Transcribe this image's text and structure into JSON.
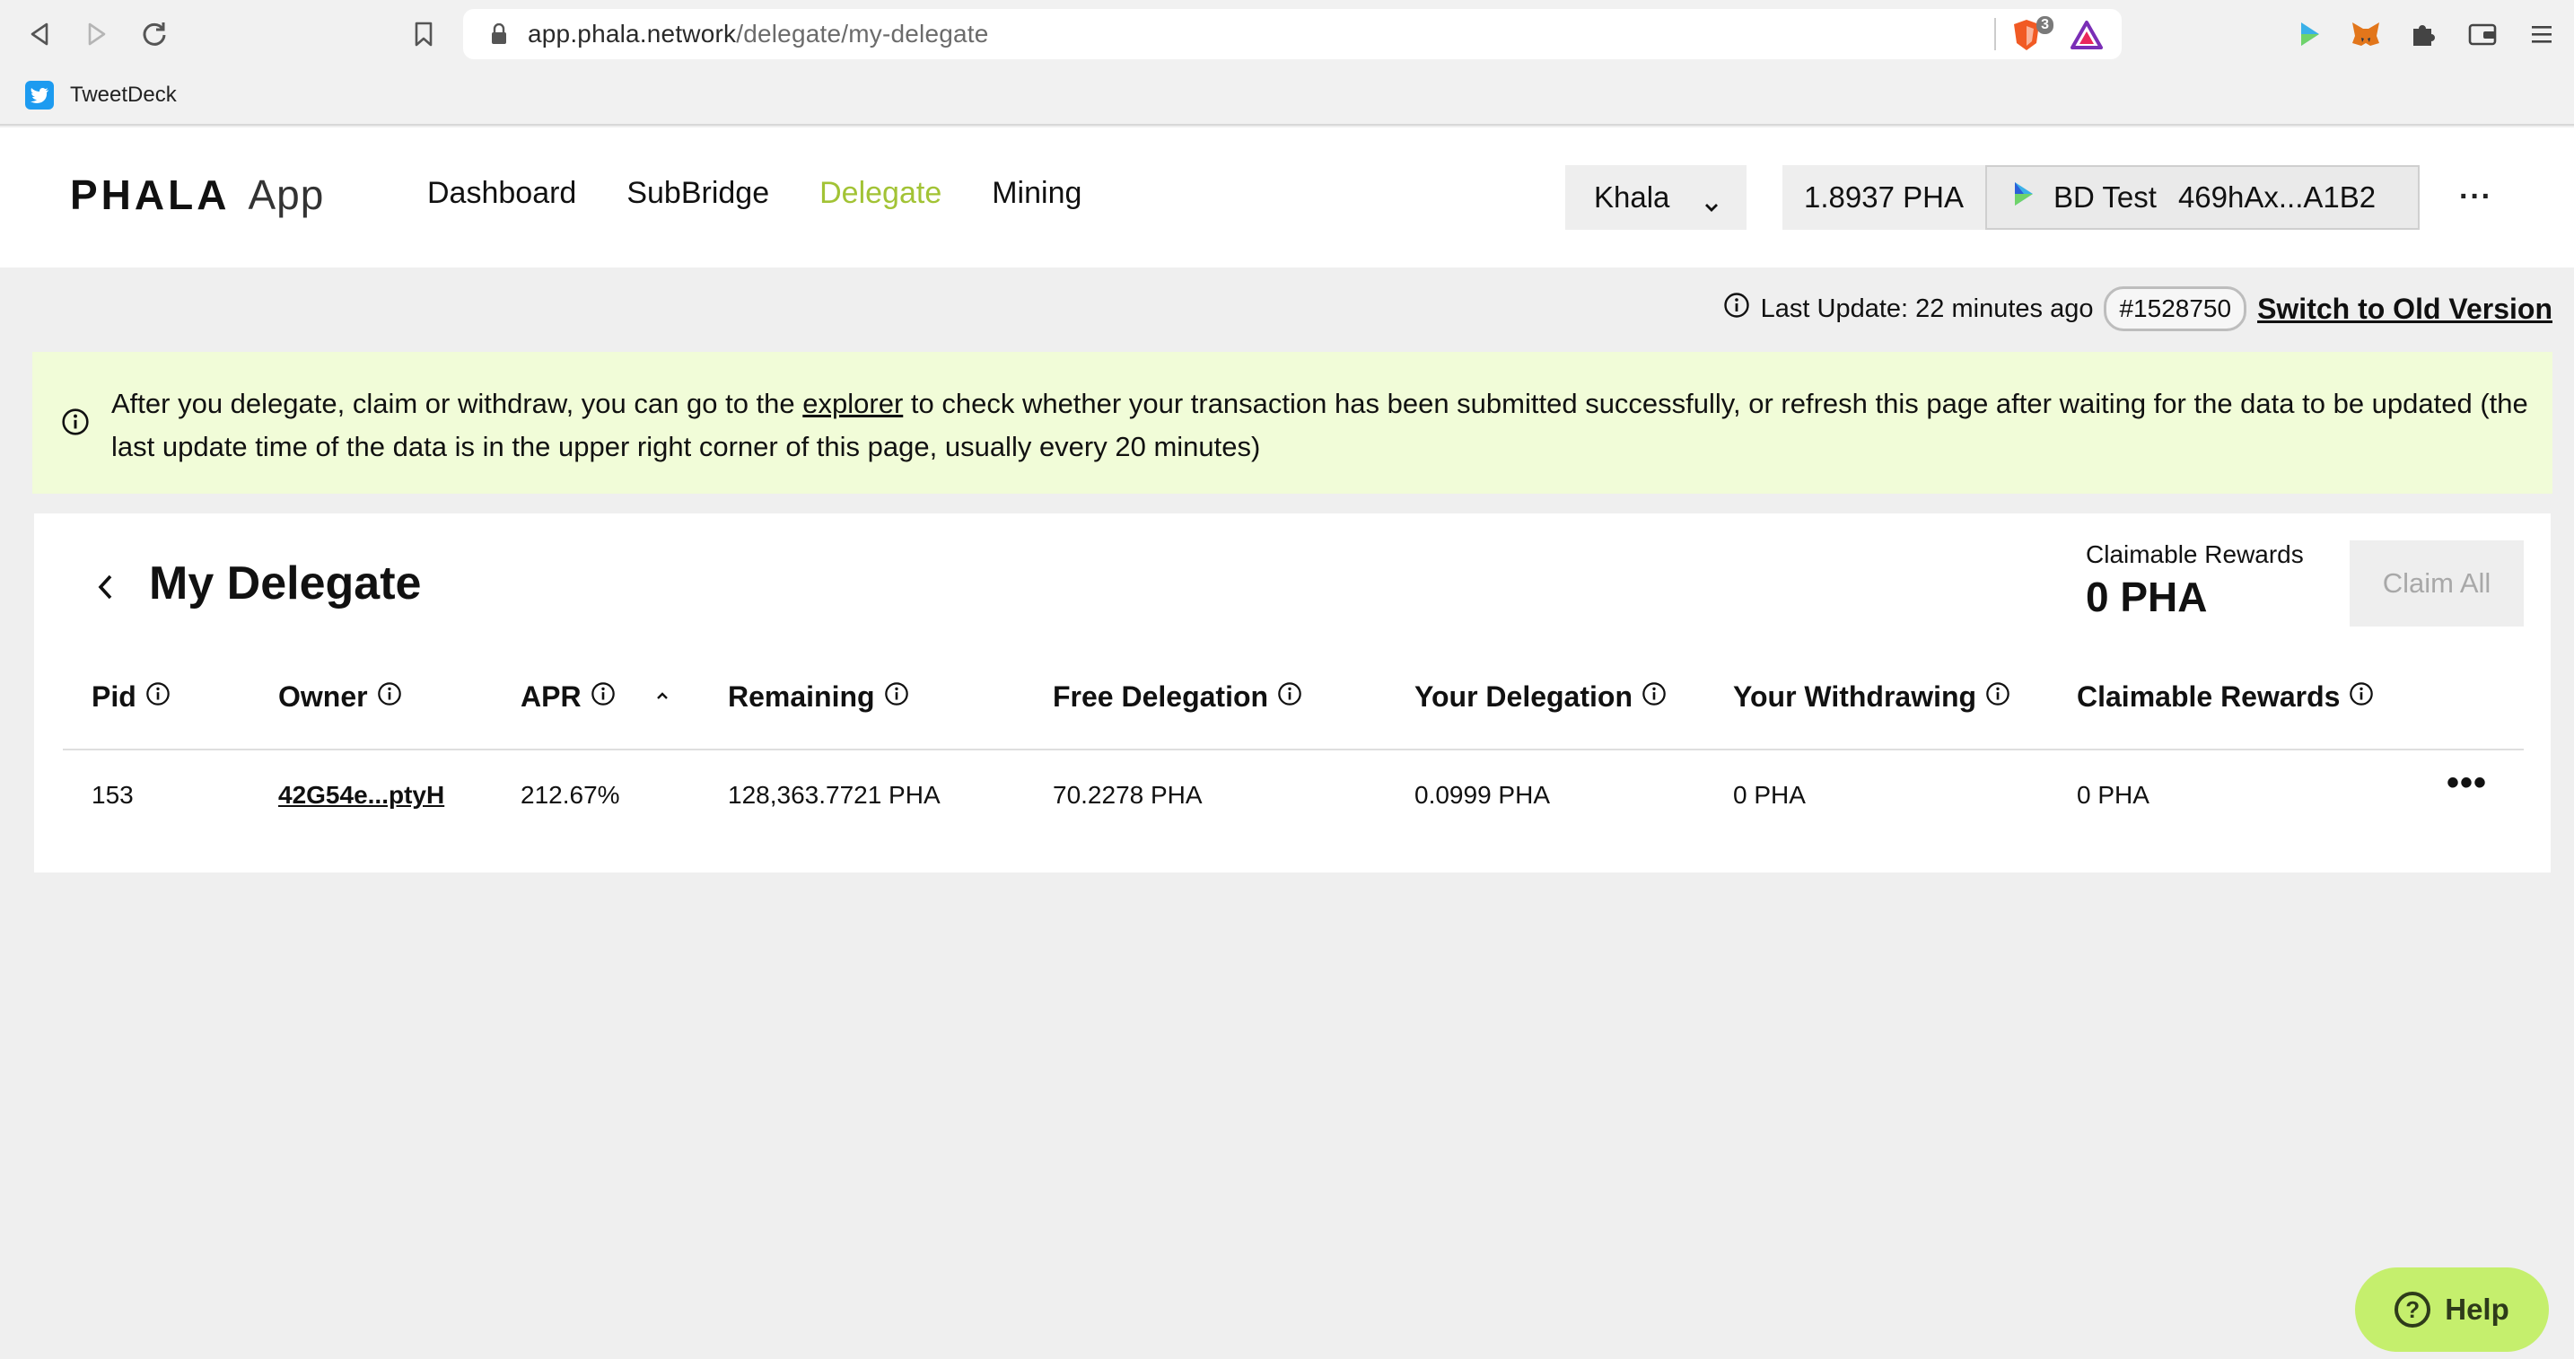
{
  "browser": {
    "url_host": "app.phala.network",
    "url_path": "/delegate/my-delegate",
    "shield_count": "3",
    "bookmark_label": "TweetDeck",
    "icons": [
      "back-icon",
      "forward-icon",
      "reload-icon",
      "bookmark-icon",
      "lock-icon",
      "brave-shield-icon",
      "brave-rewards-icon",
      "extension-icon",
      "metamask-icon",
      "puzzle-icon",
      "wallet-icon",
      "menu-icon"
    ]
  },
  "app": {
    "logo_main": "PHALA",
    "logo_app": "App",
    "nav": [
      "Dashboard",
      "SubBridge",
      "Delegate",
      "Mining"
    ],
    "active_nav": "Delegate",
    "network": "Khala",
    "balance": "1.8937 PHA",
    "account_name": "BD Test",
    "account_address": "469hAx...A1B2",
    "more": "···"
  },
  "status": {
    "last_update": "Last Update: 22 minutes ago",
    "block": "#1528750",
    "switch_label": "Switch to Old Version"
  },
  "notice": {
    "before": "After you delegate, claim or withdraw, you can go to the ",
    "link": "explorer",
    "after": " to check whether your transaction has been submitted successfully, or refresh this page after waiting for the data to be updated (the last update time of the data is in the upper right corner of this page, usually every 20 minutes)"
  },
  "panel": {
    "title": "My Delegate",
    "claimable_label": "Claimable Rewards",
    "claimable_value": "0 PHA",
    "claim_all": "Claim All",
    "columns": [
      "Pid",
      "Owner",
      "APR",
      "Remaining",
      "Free Delegation",
      "Your Delegation",
      "Your Withdrawing",
      "Claimable Rewards"
    ],
    "rows": [
      {
        "pid": "153",
        "owner": "42G54e...ptyH",
        "apr": "212.67%",
        "remaining": "128,363.7721 PHA",
        "free_delegation": "70.2278 PHA",
        "your_delegation": "0.0999 PHA",
        "your_withdrawing": "0 PHA",
        "claimable_rewards": "0 PHA"
      }
    ],
    "row_more": "•••"
  },
  "help": {
    "label": "Help"
  },
  "colors": {
    "accent": "#a2c335",
    "notice_bg": "#f1fcd8",
    "help_bg": "#c5ef6d"
  }
}
